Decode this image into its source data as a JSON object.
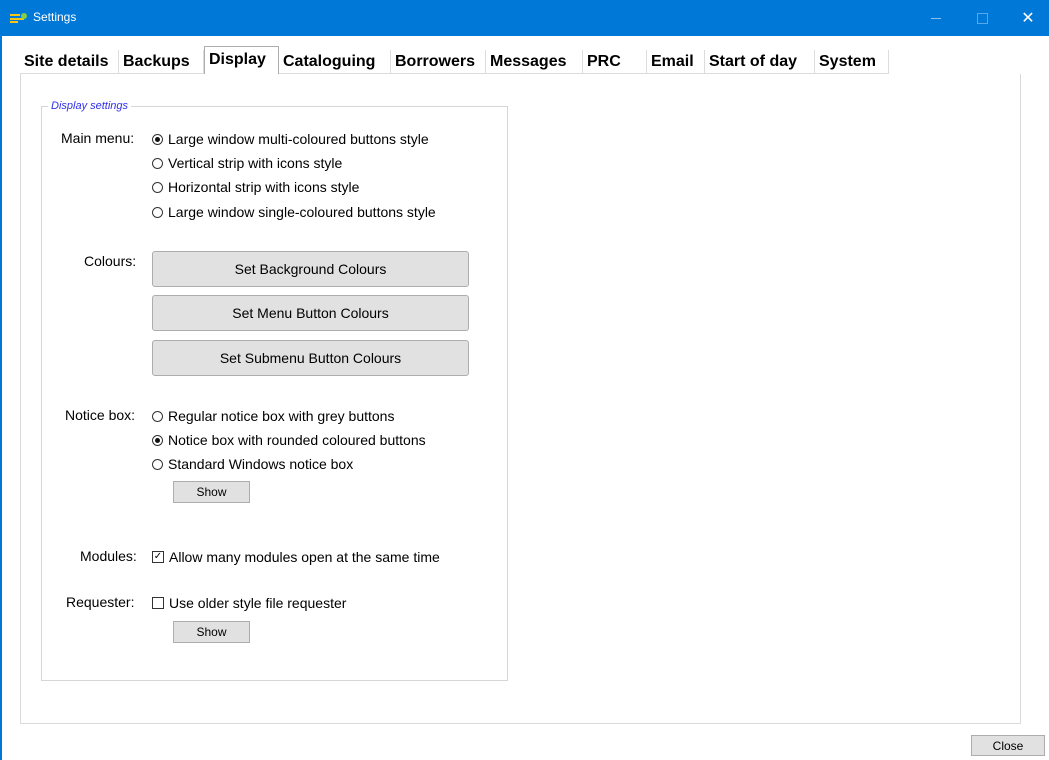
{
  "window": {
    "title": "Settings",
    "minimize_glyph": "",
    "close_glyph": "✕",
    "icon": "settings-app-icon"
  },
  "tabs": [
    {
      "label": "Site details"
    },
    {
      "label": "Backups"
    },
    {
      "label": "Display",
      "active": true
    },
    {
      "label": "Cataloguing"
    },
    {
      "label": "Borrowers"
    },
    {
      "label": "Messages"
    },
    {
      "label": "PRC"
    },
    {
      "label": "Email"
    },
    {
      "label": "Start of day"
    },
    {
      "label": "System"
    }
  ],
  "display": {
    "group_title": "Display settings",
    "main_menu": {
      "label": "Main menu:",
      "options": [
        {
          "label": "Large window multi-coloured buttons style",
          "selected": true
        },
        {
          "label": "Vertical strip with icons style",
          "selected": false
        },
        {
          "label": "Horizontal strip with icons style",
          "selected": false
        },
        {
          "label": "Large window single-coloured buttons style",
          "selected": false
        }
      ]
    },
    "colours": {
      "label": "Colours:",
      "buttons": [
        "Set Background Colours",
        "Set Menu Button Colours",
        "Set Submenu Button Colours"
      ]
    },
    "notice_box": {
      "label": "Notice box:",
      "options": [
        {
          "label": "Regular notice box with grey buttons",
          "selected": false
        },
        {
          "label": "Notice box with rounded coloured buttons",
          "selected": true
        },
        {
          "label": "Standard Windows notice box",
          "selected": false
        }
      ],
      "show_button": "Show"
    },
    "modules": {
      "label": "Modules:",
      "checkbox_label": "Allow many modules open at the same time",
      "checked": true
    },
    "requester": {
      "label": "Requester:",
      "checkbox_label": "Use older style file requester",
      "checked": false,
      "show_button": "Show"
    }
  },
  "footer": {
    "close_button": "Close"
  },
  "colors": {
    "titlebar": "#0078d7",
    "button_face": "#e1e1e1",
    "group_title": "#3030e8"
  }
}
